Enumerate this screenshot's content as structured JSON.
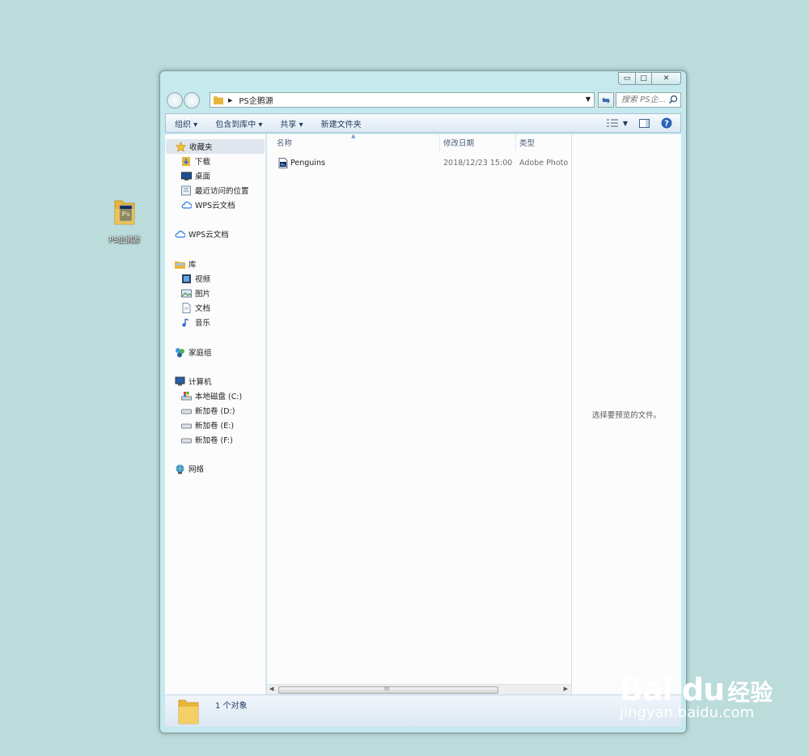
{
  "desktop": {
    "icon_label": "PS企鹅源"
  },
  "window": {
    "buttons": {
      "minimize": "▭",
      "maximize": "□",
      "close": "✕"
    },
    "address": {
      "path": "PS企鹅源"
    },
    "search": {
      "placeholder": "搜索 PS企..."
    },
    "toolbar": {
      "organize": "组织 ▾",
      "include_library": "包含到库中 ▾",
      "share": "共享 ▾",
      "new_folder": "新建文件夹"
    },
    "nav": {
      "favorites": "收藏夹",
      "downloads": "下载",
      "desktop": "桌面",
      "recent": "最近访问的位置",
      "wps_fav": "WPS云文档",
      "wps_cloud": "WPS云文档",
      "libraries": "库",
      "videos": "视频",
      "pictures": "图片",
      "documents": "文档",
      "music": "音乐",
      "homegroup": "家庭组",
      "computer": "计算机",
      "drive_c": "本地磁盘 (C:)",
      "drive_d": "新加卷 (D:)",
      "drive_e": "新加卷 (E:)",
      "drive_f": "新加卷 (F:)",
      "network": "网络"
    },
    "columns": {
      "name": "名称",
      "modified": "修改日期",
      "type": "类型"
    },
    "files": [
      {
        "name": "Penguins",
        "modified": "2018/12/23 15:00",
        "type": "Adobe Photo"
      }
    ],
    "preview_text": "选择要预览的文件。",
    "status_count": "1 个对象"
  },
  "watermark": {
    "brand": "Bai du",
    "brand_cn": "经验",
    "url": "jingyan.baidu.com"
  },
  "colors": {
    "desktop_bg": "#bcdcdc",
    "frame": "#c6e9ee",
    "folder": "#f1c24a",
    "ps_blue": "#001d4f"
  }
}
